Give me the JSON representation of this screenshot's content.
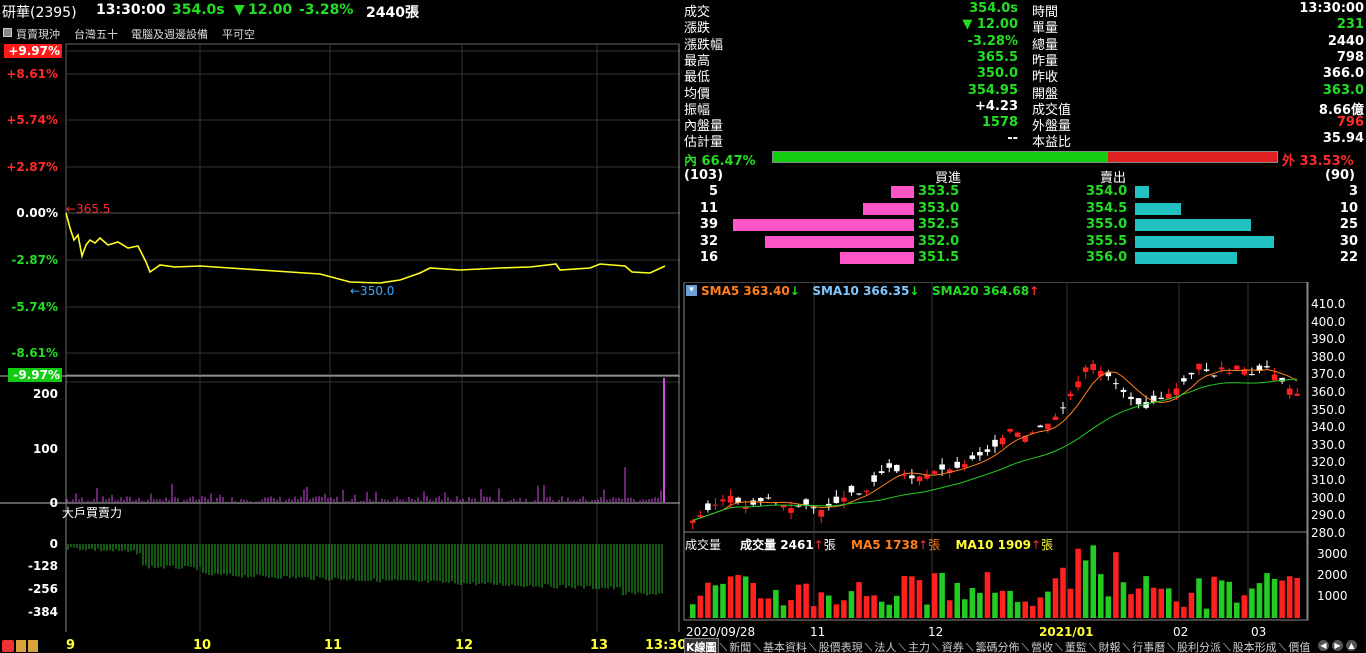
{
  "header": {
    "stock_name": "研華(2395)",
    "time": "13:30:00",
    "price": "354.0s",
    "change_arrow": "▼",
    "change": "12.00",
    "change_pct": "-3.28%",
    "volume": "2440張"
  },
  "tags": {
    "checkbox_label": "買賣現沖",
    "items": [
      "台灣五十",
      "電腦及週邊設備",
      "平可空"
    ]
  },
  "intraday": {
    "pct_labels": [
      "+9.97%",
      "+8.61%",
      "+5.74%",
      "+2.87%",
      "0.00%",
      "-2.87%",
      "-5.74%",
      "-8.61%",
      "-9.97%"
    ],
    "high_marker": "←365.5",
    "low_marker": "←350.0",
    "volume_labels": [
      "200",
      "100",
      "0"
    ],
    "bigbuyer_title": "大戶買賣力",
    "bigbuyer_labels": [
      "0",
      "-128",
      "-256",
      "-384"
    ],
    "time_labels": [
      "9",
      "10",
      "11",
      "12",
      "13",
      "13:30"
    ]
  },
  "quote": {
    "left": [
      {
        "label": "成交",
        "value": "354.0s",
        "color": "#22dd22"
      },
      {
        "label": "漲跌",
        "value": "▼ 12.00",
        "color": "#22dd22"
      },
      {
        "label": "漲跌幅",
        "value": "-3.28%",
        "color": "#22dd22"
      },
      {
        "label": "最高",
        "value": "365.5",
        "color": "#22dd22"
      },
      {
        "label": "最低",
        "value": "350.0",
        "color": "#22dd22"
      },
      {
        "label": "均價",
        "value": "354.95",
        "color": "#22dd22"
      },
      {
        "label": "振幅",
        "value": "+4.23",
        "color": "#ffffff"
      },
      {
        "label": "內盤量",
        "value": "1578",
        "color": "#22dd22"
      },
      {
        "label": "估計量",
        "value": "--",
        "color": "#ffffff"
      }
    ],
    "right": [
      {
        "label": "時間",
        "value": "13:30:00",
        "color": "#ffffff"
      },
      {
        "label": "單量",
        "value": "231",
        "color": "#22dd22"
      },
      {
        "label": "總量",
        "value": "2440",
        "color": "#ffffff"
      },
      {
        "label": "昨量",
        "value": "798",
        "color": "#ffffff"
      },
      {
        "label": "昨收",
        "value": "366.0",
        "color": "#ffffff"
      },
      {
        "label": "開盤",
        "value": "363.0",
        "color": "#22dd22"
      },
      {
        "label": "成交值",
        "value": "8.66億",
        "color": "#ffffff"
      },
      {
        "label": "外盤量",
        "value": "796",
        "color": "#ff2a2a"
      },
      {
        "label": "本益比",
        "value": "35.94",
        "color": "#ffffff"
      }
    ],
    "inner_label": "內 66.47%",
    "outer_label": "外 33.53%",
    "inner_ratio": 0.6647
  },
  "orderbook": {
    "bid_title": "買進",
    "ask_title": "賣出",
    "bid_total": "(103)",
    "ask_total": "(90)",
    "bids": [
      {
        "qty": "5",
        "price": "353.5",
        "n": 5
      },
      {
        "qty": "11",
        "price": "353.0",
        "n": 11
      },
      {
        "qty": "39",
        "price": "352.5",
        "n": 39
      },
      {
        "qty": "32",
        "price": "352.0",
        "n": 32
      },
      {
        "qty": "16",
        "price": "351.5",
        "n": 16
      }
    ],
    "asks": [
      {
        "qty": "3",
        "price": "354.0",
        "n": 3
      },
      {
        "qty": "10",
        "price": "354.5",
        "n": 10
      },
      {
        "qty": "25",
        "price": "355.0",
        "n": 25
      },
      {
        "qty": "30",
        "price": "355.5",
        "n": 30
      },
      {
        "qty": "22",
        "price": "356.0",
        "n": 22
      }
    ]
  },
  "kline": {
    "sma5": "SMA5 363.40",
    "sma10": "SMA10 366.35",
    "sma20": "SMA20 364.68",
    "price_labels": [
      "410.0",
      "400.0",
      "390.0",
      "380.0",
      "370.0",
      "360.0",
      "350.0",
      "340.0",
      "330.0",
      "320.0",
      "310.0",
      "300.0",
      "290.0",
      "280.0"
    ],
    "vol_title": "成交量",
    "vol_value": "成交量 2461",
    "vol_ma5": "MA5 1738",
    "vol_ma10": "MA10 1909",
    "unit": "張",
    "vol_labels": [
      "3000",
      "2000",
      "1000"
    ],
    "date_labels": [
      "2020/09/28",
      "11",
      "12",
      "2021/01",
      "02",
      "03"
    ]
  },
  "tabs": [
    "K線圖",
    "新聞",
    "基本資料",
    "股價表現",
    "法人",
    "主力",
    "資券",
    "籌碼分佈",
    "營收",
    "董監",
    "財報",
    "行事曆",
    "股利分派",
    "股本形成",
    "價值"
  ]
}
